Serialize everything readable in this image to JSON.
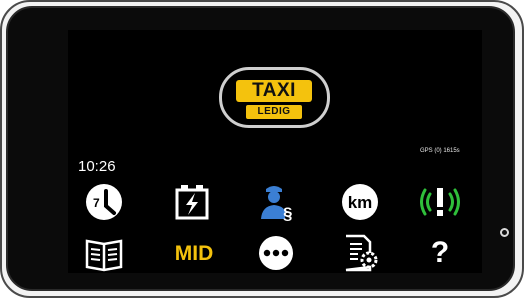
{
  "taxi_sign": {
    "top_text": "TAXI",
    "bottom_text": "LEDIG"
  },
  "status": {
    "gps_text": "GPS (0) 1615s",
    "clock": "10:26"
  },
  "menu": {
    "row1": [
      {
        "icon": "shift-clock-icon",
        "label": "7"
      },
      {
        "icon": "battery-charge-icon"
      },
      {
        "icon": "officer-legal-icon"
      },
      {
        "icon": "km-icon",
        "label": "km"
      },
      {
        "icon": "alert-signal-icon"
      }
    ],
    "row2": [
      {
        "icon": "book-icon"
      },
      {
        "icon": "mid-icon",
        "label": "MID"
      },
      {
        "icon": "more-icon"
      },
      {
        "icon": "document-settings-icon"
      },
      {
        "icon": "help-icon",
        "label": "?"
      }
    ]
  },
  "colors": {
    "accent_yellow": "#f4c20d",
    "officer_blue": "#3b7fd4",
    "signal_green": "#2fbf3a",
    "screen_bg": "#000000"
  }
}
